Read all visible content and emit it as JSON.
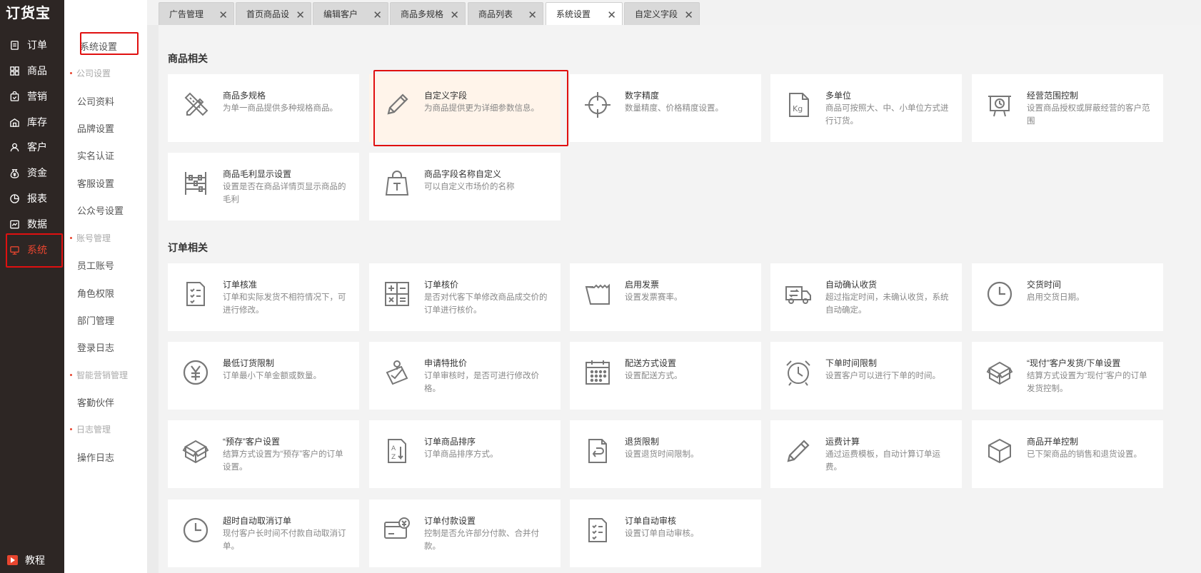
{
  "brand": {
    "logo": "订货宝"
  },
  "nav": {
    "items": [
      {
        "label": "订单",
        "icon": "order-icon"
      },
      {
        "label": "商品",
        "icon": "grid-icon"
      },
      {
        "label": "营销",
        "icon": "bag-icon"
      },
      {
        "label": "库存",
        "icon": "warehouse-icon"
      },
      {
        "label": "客户",
        "icon": "user-icon"
      },
      {
        "label": "资金",
        "icon": "money-bag-icon"
      },
      {
        "label": "报表",
        "icon": "pie-chart-icon"
      },
      {
        "label": "数据",
        "icon": "data-icon"
      },
      {
        "label": "系统",
        "icon": "monitor-icon"
      }
    ],
    "bottom": {
      "label": "教程",
      "icon": "play-icon"
    },
    "active_color": "#e8452f",
    "bg_color": "#2d2624"
  },
  "submenu": {
    "current": "系统设置",
    "groups": [
      {
        "title": "公司设置",
        "items": [
          "公司资料",
          "品牌设置",
          "实名认证",
          "客服设置",
          "公众号设置"
        ]
      },
      {
        "title": "账号管理",
        "items": [
          "员工账号",
          "角色权限",
          "部门管理",
          "登录日志"
        ]
      },
      {
        "title": "智能营销管理",
        "items": [
          "客勤伙伴"
        ]
      },
      {
        "title": "日志管理",
        "items": [
          "操作日志"
        ]
      }
    ]
  },
  "tabs": [
    {
      "label": "广告管理",
      "active": false
    },
    {
      "label": "首页商品设置",
      "active": false
    },
    {
      "label": "编辑客户",
      "active": false
    },
    {
      "label": "商品多规格",
      "active": false
    },
    {
      "label": "商品列表",
      "active": false
    },
    {
      "label": "系统设置",
      "active": true
    },
    {
      "label": "自定义字段",
      "active": false
    }
  ],
  "sections": [
    {
      "title": "商品相关",
      "cards": [
        {
          "title": "商品多规格",
          "desc": "为单一商品提供多种规格商品。",
          "icon": "pencil-ruler-icon"
        },
        {
          "title": "自定义字段",
          "desc": "为商品提供更为详细参数信息。",
          "icon": "pencil-icon",
          "highlight": true
        },
        {
          "title": "数字精度",
          "desc": "数量精度、价格精度设置。",
          "icon": "crosshair-icon"
        },
        {
          "title": "多单位",
          "desc": "商品可按照大、中、小单位方式进行订货。",
          "icon": "kg-file-icon"
        },
        {
          "title": "经营范围控制",
          "desc": "设置商品授权或屏蔽经营的客户范围",
          "icon": "presentation-icon"
        },
        {
          "title": "商品毛利显示设置",
          "desc": "设置是否在商品详情页显示商品的毛利",
          "icon": "abacus-icon"
        },
        {
          "title": "商品字段名称自定义",
          "desc": "可以自定义市场价的名称",
          "icon": "text-bag-icon"
        }
      ]
    },
    {
      "title": "订单相关",
      "cards": [
        {
          "title": "订单核准",
          "desc": "订单和实际发货不相符情况下，可进行修改。",
          "icon": "checklist-file-icon"
        },
        {
          "title": "订单核价",
          "desc": "是否对代客下单修改商品成交价的订单进行核价。",
          "icon": "calculator-icon"
        },
        {
          "title": "启用发票",
          "desc": "设置发票赛率。",
          "icon": "invoice-icon"
        },
        {
          "title": "自动确认收货",
          "desc": "超过指定时间，未确认收货，系统自动确定。",
          "icon": "truck-icon"
        },
        {
          "title": "交货时间",
          "desc": "启用交货日期。",
          "icon": "clock-icon"
        },
        {
          "title": "最低订货限制",
          "desc": "订单最小下单金额或数量。",
          "icon": "yen-icon"
        },
        {
          "title": "申请特批价",
          "desc": "订单审核时，是否可进行修改价格。",
          "icon": "approval-icon"
        },
        {
          "title": "配送方式设置",
          "desc": "设置配送方式。",
          "icon": "calendar-icon"
        },
        {
          "title": "下单时间限制",
          "desc": "设置客户可以进行下单的时间。",
          "icon": "alarm-icon"
        },
        {
          "title": "“现付”客户发货/下单设置",
          "desc": "结算方式设置为“现付”客户的订单发货控制。",
          "icon": "box-open-icon"
        },
        {
          "title": "“预存”客户设置",
          "desc": "结算方式设置为“预存”客户的订单设置。",
          "icon": "box-open-icon"
        },
        {
          "title": "订单商品排序",
          "desc": "订单商品排序方式。",
          "icon": "sort-az-icon"
        },
        {
          "title": "退货限制",
          "desc": "设置退货时间限制。",
          "icon": "return-file-icon"
        },
        {
          "title": "运费计算",
          "desc": "通过运费模板，自动计算订单运费。",
          "icon": "pen-icon"
        },
        {
          "title": "商品开单控制",
          "desc": "已下架商品的销售和退货设置。",
          "icon": "cube-icon"
        },
        {
          "title": "超时自动取消订单",
          "desc": "现付客户长时间不付款自动取消订单。",
          "icon": "clock-icon"
        },
        {
          "title": "订单付款设置",
          "desc": "控制是否允许部分付款、合并付款。",
          "icon": "payment-card-icon"
        },
        {
          "title": "订单自动审核",
          "desc": "设置订单自动审核。",
          "icon": "checklist-file-icon"
        }
      ]
    }
  ]
}
